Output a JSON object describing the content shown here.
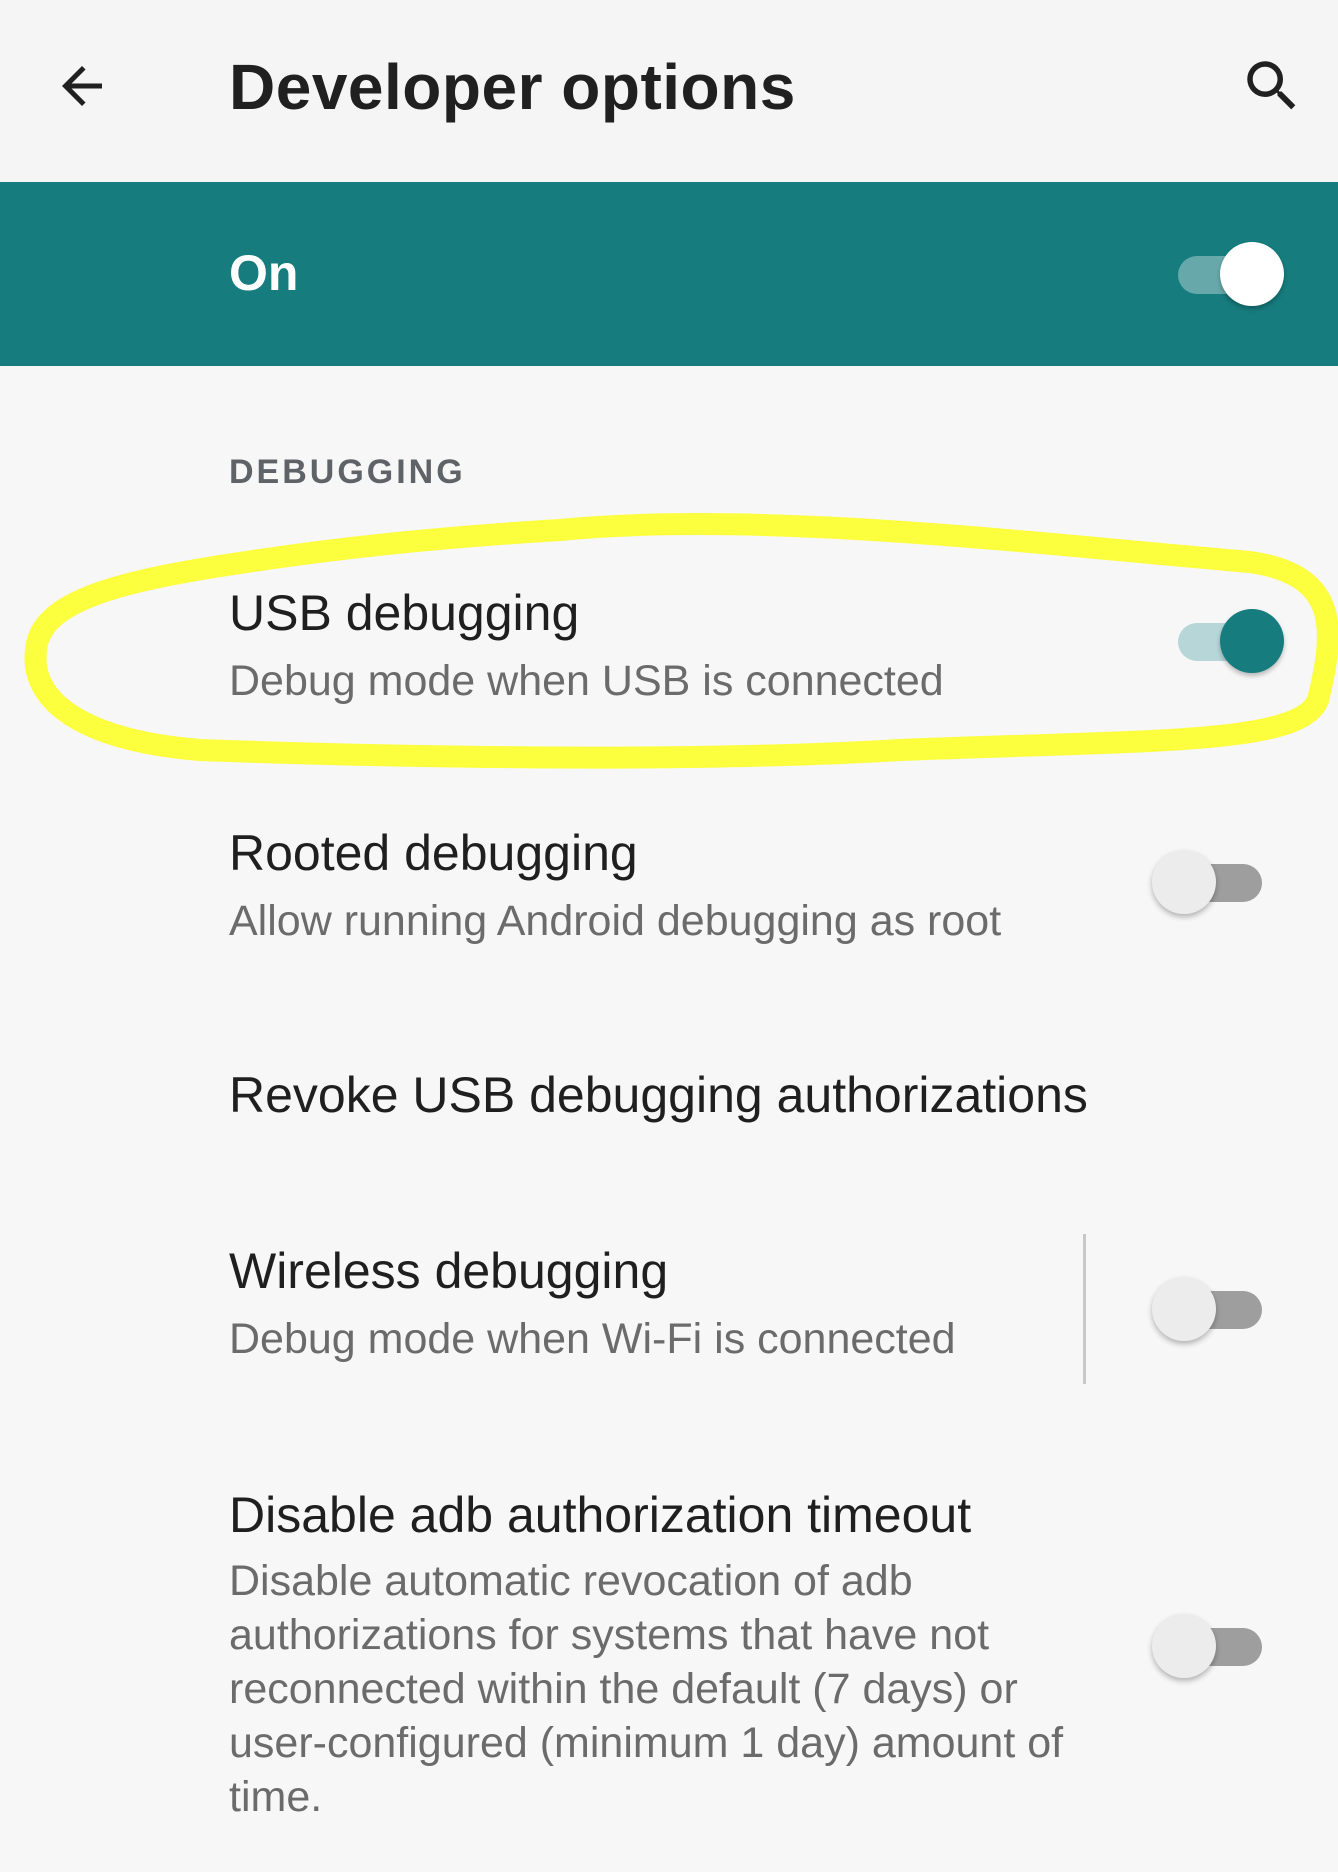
{
  "colors": {
    "accent": "#167c7e",
    "highlight": "#fbff3e"
  },
  "appbar": {
    "back_icon": "arrow-back-icon",
    "title": "Developer options",
    "search_icon": "search-icon"
  },
  "master": {
    "label": "On",
    "checked": true
  },
  "section": {
    "header": "DEBUGGING"
  },
  "settings": [
    {
      "title": "USB debugging",
      "summary": "Debug mode when USB is connected",
      "checked": true
    },
    {
      "title": "Rooted debugging",
      "summary": "Allow running Android debugging as root",
      "checked": false
    },
    {
      "title": "Revoke USB debugging authorizations"
    },
    {
      "title": "Wireless debugging",
      "summary": "Debug mode when Wi-Fi is connected",
      "checked": false
    },
    {
      "title": "Disable adb authorization timeout",
      "summary": "Disable automatic revocation of adb authorizations for systems that have not reconnected within the default (7 days) or user-configured (minimum 1 day) amount of time.",
      "checked": false
    }
  ]
}
